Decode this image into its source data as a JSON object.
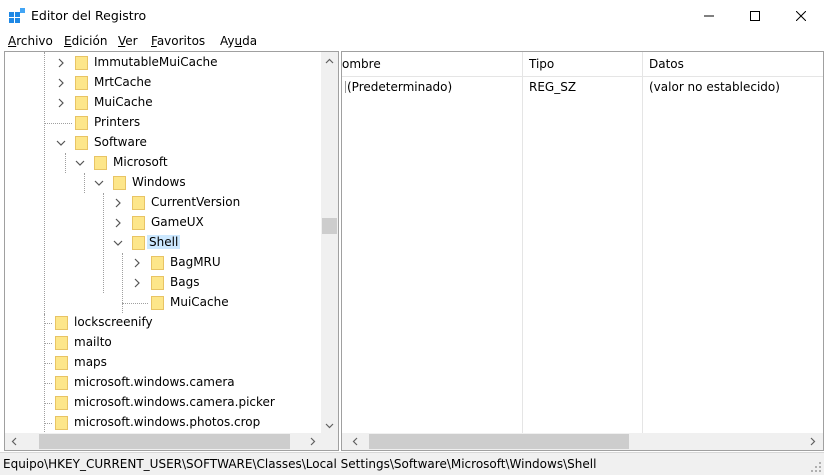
{
  "window": {
    "title": "Editor del Registro",
    "controls": {
      "minimize": "minimize-icon",
      "maximize": "maximize-icon",
      "close": "close-icon"
    }
  },
  "menu": [
    {
      "pre": "",
      "acc": "A",
      "post": "rchivo"
    },
    {
      "pre": "",
      "acc": "E",
      "post": "dición"
    },
    {
      "pre": "",
      "acc": "V",
      "post": "er"
    },
    {
      "pre": "",
      "acc": "F",
      "post": "avoritos"
    },
    {
      "pre": "Ay",
      "acc": "u",
      "post": "da"
    }
  ],
  "tree": [
    {
      "label": "ImmutableMuiCache",
      "expander": "collapsed"
    },
    {
      "label": "MrtCache",
      "expander": "collapsed"
    },
    {
      "label": "MuiCache",
      "expander": "collapsed"
    },
    {
      "label": "Printers",
      "expander": "none"
    },
    {
      "label": "Software",
      "expander": "expanded"
    },
    {
      "label": "Microsoft",
      "expander": "expanded"
    },
    {
      "label": "Windows",
      "expander": "expanded"
    },
    {
      "label": "CurrentVersion",
      "expander": "collapsed"
    },
    {
      "label": "GameUX",
      "expander": "collapsed"
    },
    {
      "label": "Shell",
      "expander": "expanded",
      "selected": true
    },
    {
      "label": "BagMRU",
      "expander": "collapsed"
    },
    {
      "label": "Bags",
      "expander": "collapsed"
    },
    {
      "label": "MuiCache",
      "expander": "none"
    },
    {
      "label": "lockscreenify",
      "expander": "none"
    },
    {
      "label": "mailto",
      "expander": "none"
    },
    {
      "label": "maps",
      "expander": "none"
    },
    {
      "label": "microsoft.windows.camera",
      "expander": "none"
    },
    {
      "label": "microsoft.windows.camera.picker",
      "expander": "none"
    },
    {
      "label": "microsoft.windows.photos.crop",
      "expander": "none"
    }
  ],
  "list": {
    "columns": [
      "ombre",
      "Tipo",
      "Datos"
    ],
    "rows": [
      {
        "name": "(Predeterminado)",
        "type": "REG_SZ",
        "data": "(valor no establecido)"
      }
    ]
  },
  "status": {
    "path": "Equipo\\HKEY_CURRENT_USER\\SOFTWARE\\Classes\\Local Settings\\Software\\Microsoft\\Windows\\Shell"
  },
  "colors": {
    "folder": "#fde68a",
    "selection": "#cce8ff",
    "icon_blue": "#1e88e5"
  }
}
